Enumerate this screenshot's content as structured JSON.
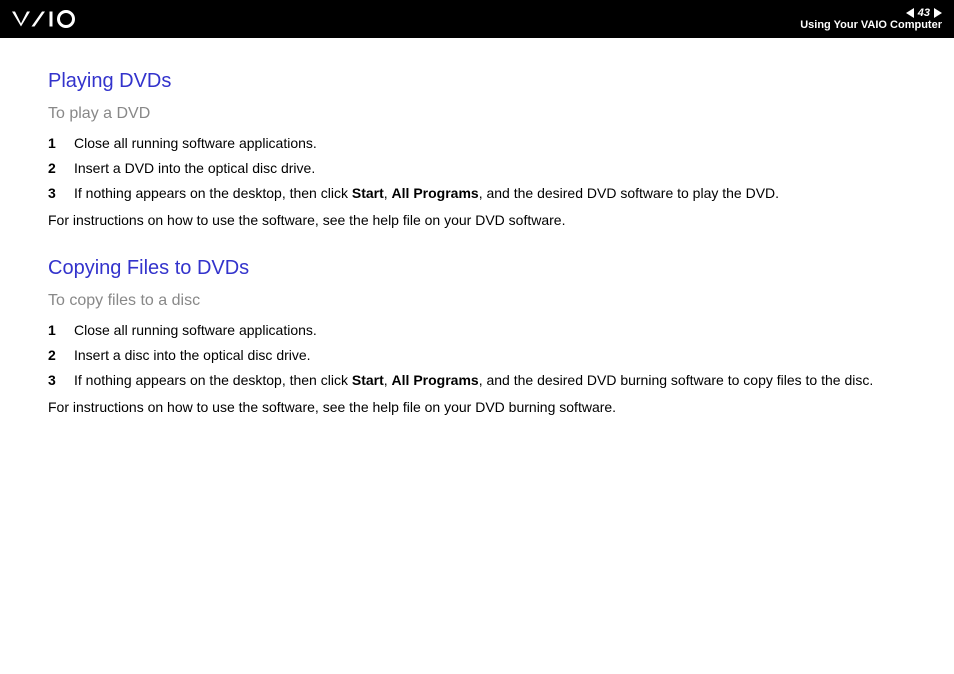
{
  "header": {
    "page_number": "43",
    "section_title": "Using Your VAIO Computer"
  },
  "section1": {
    "heading": "Playing DVDs",
    "subheading": "To play a DVD",
    "steps": [
      {
        "num": "1",
        "text": "Close all running software applications."
      },
      {
        "num": "2",
        "text": "Insert a DVD into the optical disc drive."
      },
      {
        "num": "3",
        "prefix": "If nothing appears on the desktop, then click ",
        "bold1": "Start",
        "mid1": ", ",
        "bold2": "All Programs",
        "suffix": ", and the desired DVD software to play the DVD."
      }
    ],
    "note": "For instructions on how to use the software, see the help file on your DVD software."
  },
  "section2": {
    "heading": "Copying Files to DVDs",
    "subheading": "To copy files to a disc",
    "steps": [
      {
        "num": "1",
        "text": "Close all running software applications."
      },
      {
        "num": "2",
        "text": "Insert a disc into the optical disc drive."
      },
      {
        "num": "3",
        "prefix": "If nothing appears on the desktop, then click ",
        "bold1": "Start",
        "mid1": ", ",
        "bold2": "All Programs",
        "suffix": ", and the desired DVD burning software to copy files to the disc."
      }
    ],
    "note": "For instructions on how to use the software, see the help file on your DVD burning software."
  }
}
